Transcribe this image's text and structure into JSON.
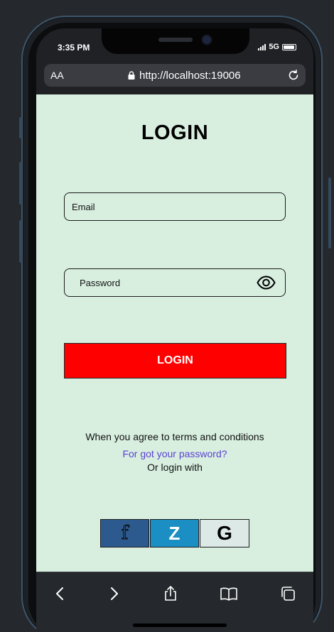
{
  "status_bar": {
    "time": "3:35 PM",
    "network": "5G"
  },
  "browser": {
    "text_size_label": "AA",
    "url": "http://localhost:19006"
  },
  "login_page": {
    "title": "LOGIN",
    "email_placeholder": "Email",
    "password_placeholder": "Password",
    "login_button_label": "LOGIN",
    "terms_text": "When you agree to terms and conditions",
    "forgot_password_link": "For got your password?",
    "or_login_with_text": "Or login with",
    "social": {
      "facebook_glyph": "f",
      "zalo_glyph": "Z",
      "google_glyph": "G"
    }
  },
  "colors": {
    "page_background": "#d8efe0",
    "login_button": "#ff0000",
    "link": "#5b3fd1",
    "facebook": "#2d5a8e",
    "zalo": "#1b8fc4"
  },
  "icons": [
    "lock-icon",
    "reload-icon",
    "eye-icon",
    "back-icon",
    "forward-icon",
    "share-icon",
    "bookmarks-icon",
    "tabs-icon"
  ]
}
